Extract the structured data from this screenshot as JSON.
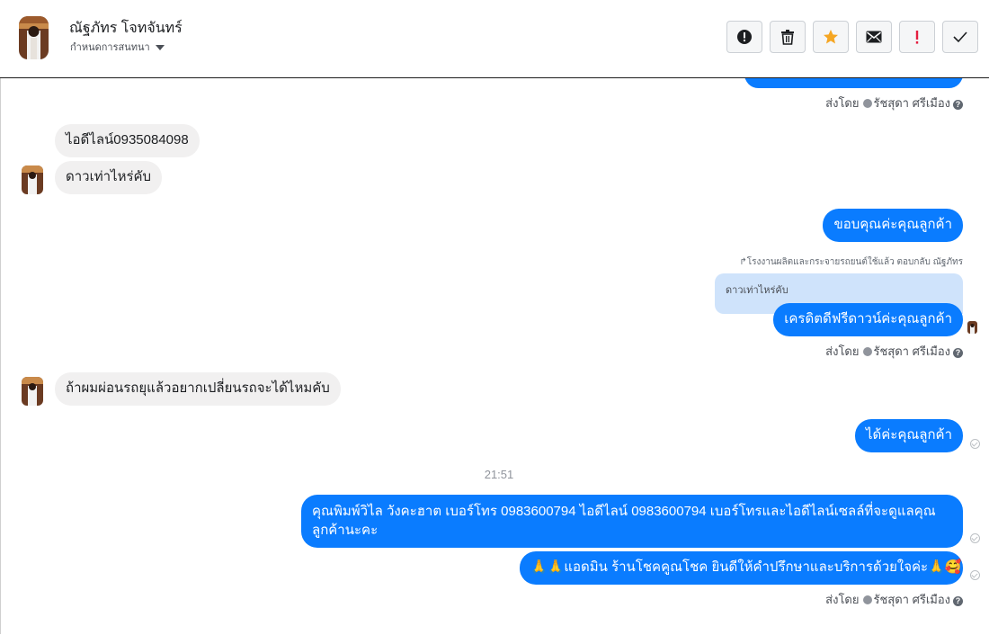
{
  "header": {
    "contact_name": "ณัฐภัทร โจทจันทร์",
    "subtitle": "กำหนดการสนทนา"
  },
  "toolbar": {
    "buttons": [
      {
        "name": "alert-circle-icon",
        "color": "#1c1e21"
      },
      {
        "name": "trash-icon",
        "color": "#1c1e21"
      },
      {
        "name": "star-icon",
        "color": "#f5a623"
      },
      {
        "name": "envelope-icon",
        "color": "#1c1e21"
      },
      {
        "name": "exclamation-icon",
        "color": "#e41e3f"
      },
      {
        "name": "checkmark-icon",
        "color": "#1c1e21"
      }
    ]
  },
  "colors": {
    "outgoing_bubble": "#0a7cff",
    "incoming_bubble": "#f1f0f0",
    "quote_bg": "#cfe3fb"
  },
  "messages": {
    "sent_by_label": "ส่งโดย",
    "sender": "รัชสุดา ศรีเมือง",
    "line_id": "ไอดีไลน์0935084098",
    "how_much_down": "ดาวเท่าไหร่คับ",
    "thanks_customer": "ขอบคุณค่ะคุณลูกค้า",
    "reply_note": "↱โรงงานผลิตและกระจายรถยนต์ใช้แล้ว ตอบกลับ ณัฐภัทร",
    "quoted_text": "ดาวเท่าไหร่คับ",
    "credit_free_down": "เครดิตดีฟรีดาวน์ค่ะคุณลูกค้า",
    "want_change_car": "ถ้าผมผ่อนรถยุแล้วอยากเปลี่ยนรถจะได้ไหมคับ",
    "yes_customer": "ได้ค่ะคุณลูกค้า",
    "timestamp": "21:51",
    "contact_info": "คุณพิมพ์วิไล วังคะฮาต   เบอร์โทร 0983600794  ไอดีไลน์ 0983600794   เบอร์โทรและไอดีไลน์เซลล์ที่จะดูแลคุณลูกค้านะคะ",
    "admin_greeting": "🙏🙏แอดมิน ร้านโชคคูณโชค ยินดีให้คำปรึกษาและบริการด้วยใจค่ะ🙏🥰"
  }
}
